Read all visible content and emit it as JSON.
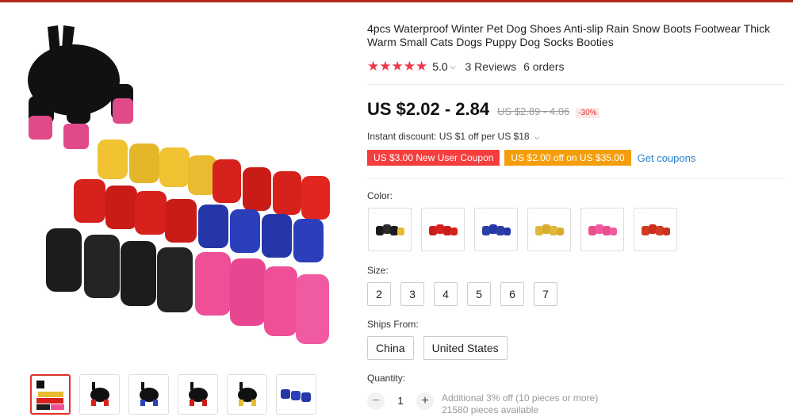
{
  "product": {
    "title": "4pcs Waterproof Winter Pet Dog Shoes Anti-slip Rain Snow Boots Footwear Thick Warm Small Cats Dogs Puppy Dog Socks Booties",
    "stars": "★★★★★",
    "rating": "5.0",
    "reviews": "3 Reviews",
    "orders": "6 orders",
    "price": "US $2.02 - 2.84",
    "original_price": "US $2.89 - 4.06",
    "discount": "-30%",
    "instant_discount": "Instant discount: US $1 off per US $18"
  },
  "coupons": {
    "items": [
      "US $3.00 New User Coupon",
      "US $2.00 off on US $35.00"
    ],
    "get_label": "Get coupons",
    "colors": {
      "red": "#f43e3e",
      "orange": "#f59e0b"
    }
  },
  "color": {
    "label": "Color:",
    "options": [
      {
        "icon": "black-boots-icon",
        "tint": "#1a1a1a"
      },
      {
        "icon": "red-boots-icon",
        "tint": "#c81e1e"
      },
      {
        "icon": "blue-boots-icon",
        "tint": "#2c3fa8"
      },
      {
        "icon": "yellow-boots-icon",
        "tint": "#e0b83a"
      },
      {
        "icon": "pink-boots-icon",
        "tint": "#e8508c"
      },
      {
        "icon": "orange-red-boots-icon",
        "tint": "#d23a22"
      }
    ]
  },
  "size": {
    "label": "Size:",
    "options": [
      "2",
      "3",
      "4",
      "5",
      "6",
      "7"
    ]
  },
  "ships_from": {
    "label": "Ships From:",
    "options": [
      "China",
      "United States"
    ]
  },
  "quantity": {
    "label": "Quantity:",
    "minus": "−",
    "value": "1",
    "plus": "+",
    "note1": "Additional 3% off (10 pieces or more)",
    "note2": "21580 pieces available"
  }
}
